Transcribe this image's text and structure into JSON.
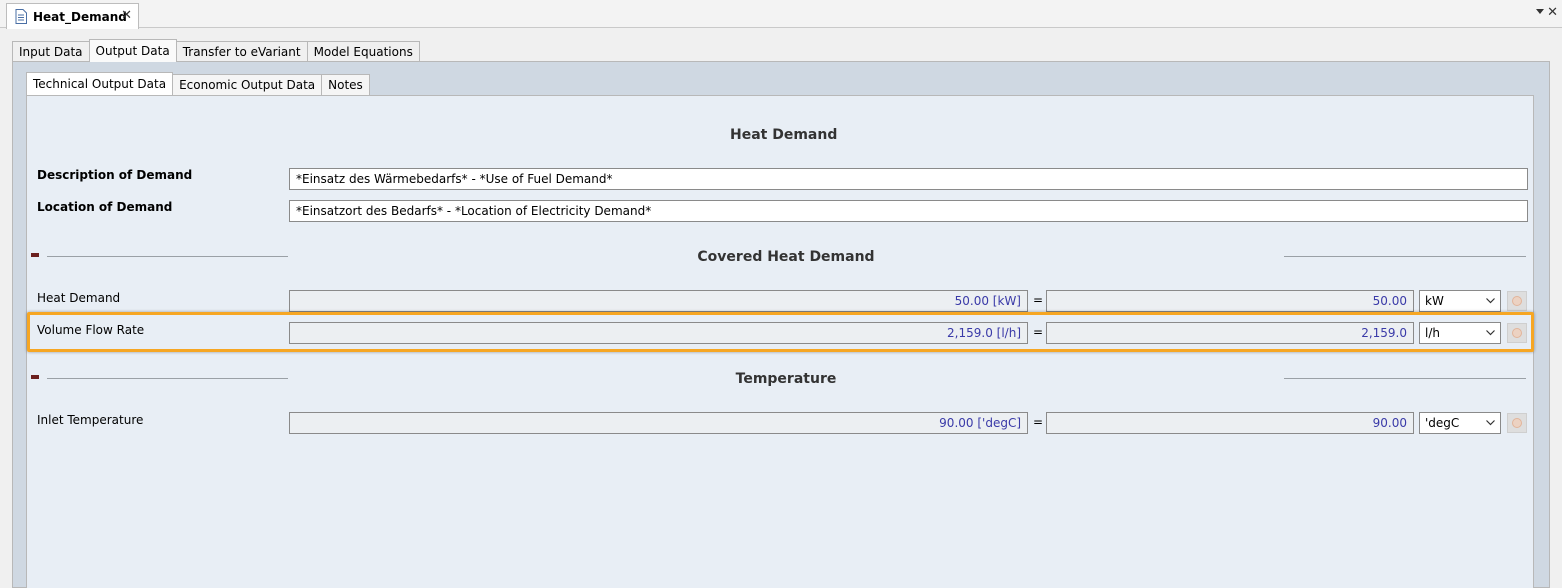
{
  "document_tab": {
    "title": "Heat_Demand"
  },
  "outer_tabs": [
    {
      "label": "Input Data"
    },
    {
      "label": "Output Data"
    },
    {
      "label": "Transfer to eVariant"
    },
    {
      "label": "Model Equations"
    }
  ],
  "inner_tabs": [
    {
      "label": "Technical Output Data"
    },
    {
      "label": "Economic Output Data"
    },
    {
      "label": "Notes"
    }
  ],
  "heat_demand_section": {
    "title": "Heat Demand",
    "description_label": "Description of Demand",
    "description_value": "*Einsatz des Wärmebedarfs* - *Use of Fuel Demand*",
    "location_label": "Location of Demand",
    "location_value": "*Einsatzort des Bedarfs* - *Location of Electricity Demand*"
  },
  "covered_section": {
    "title": "Covered Heat Demand",
    "rows": [
      {
        "label": "Heat Demand",
        "calc_value": "50.00 [kW]",
        "equals": "=",
        "value": "50.00",
        "unit": "kW"
      },
      {
        "label": "Volume Flow Rate",
        "calc_value": "2,159.0 [l/h]",
        "equals": "=",
        "value": "2,159.0",
        "unit": "l/h"
      }
    ]
  },
  "temperature_section": {
    "title": "Temperature",
    "rows": [
      {
        "label": "Inlet Temperature",
        "calc_value": "90.00 ['degC]",
        "equals": "=",
        "value": "90.00",
        "unit": "'degC"
      }
    ]
  },
  "colors": {
    "highlight": "#f6a623",
    "value_text": "#3a3aa8",
    "panel_bg": "#e8eef5"
  },
  "icons": [
    "document-icon",
    "close-icon",
    "window-menu-icon",
    "collapse-icon",
    "chevron-down-icon",
    "circle-icon"
  ]
}
